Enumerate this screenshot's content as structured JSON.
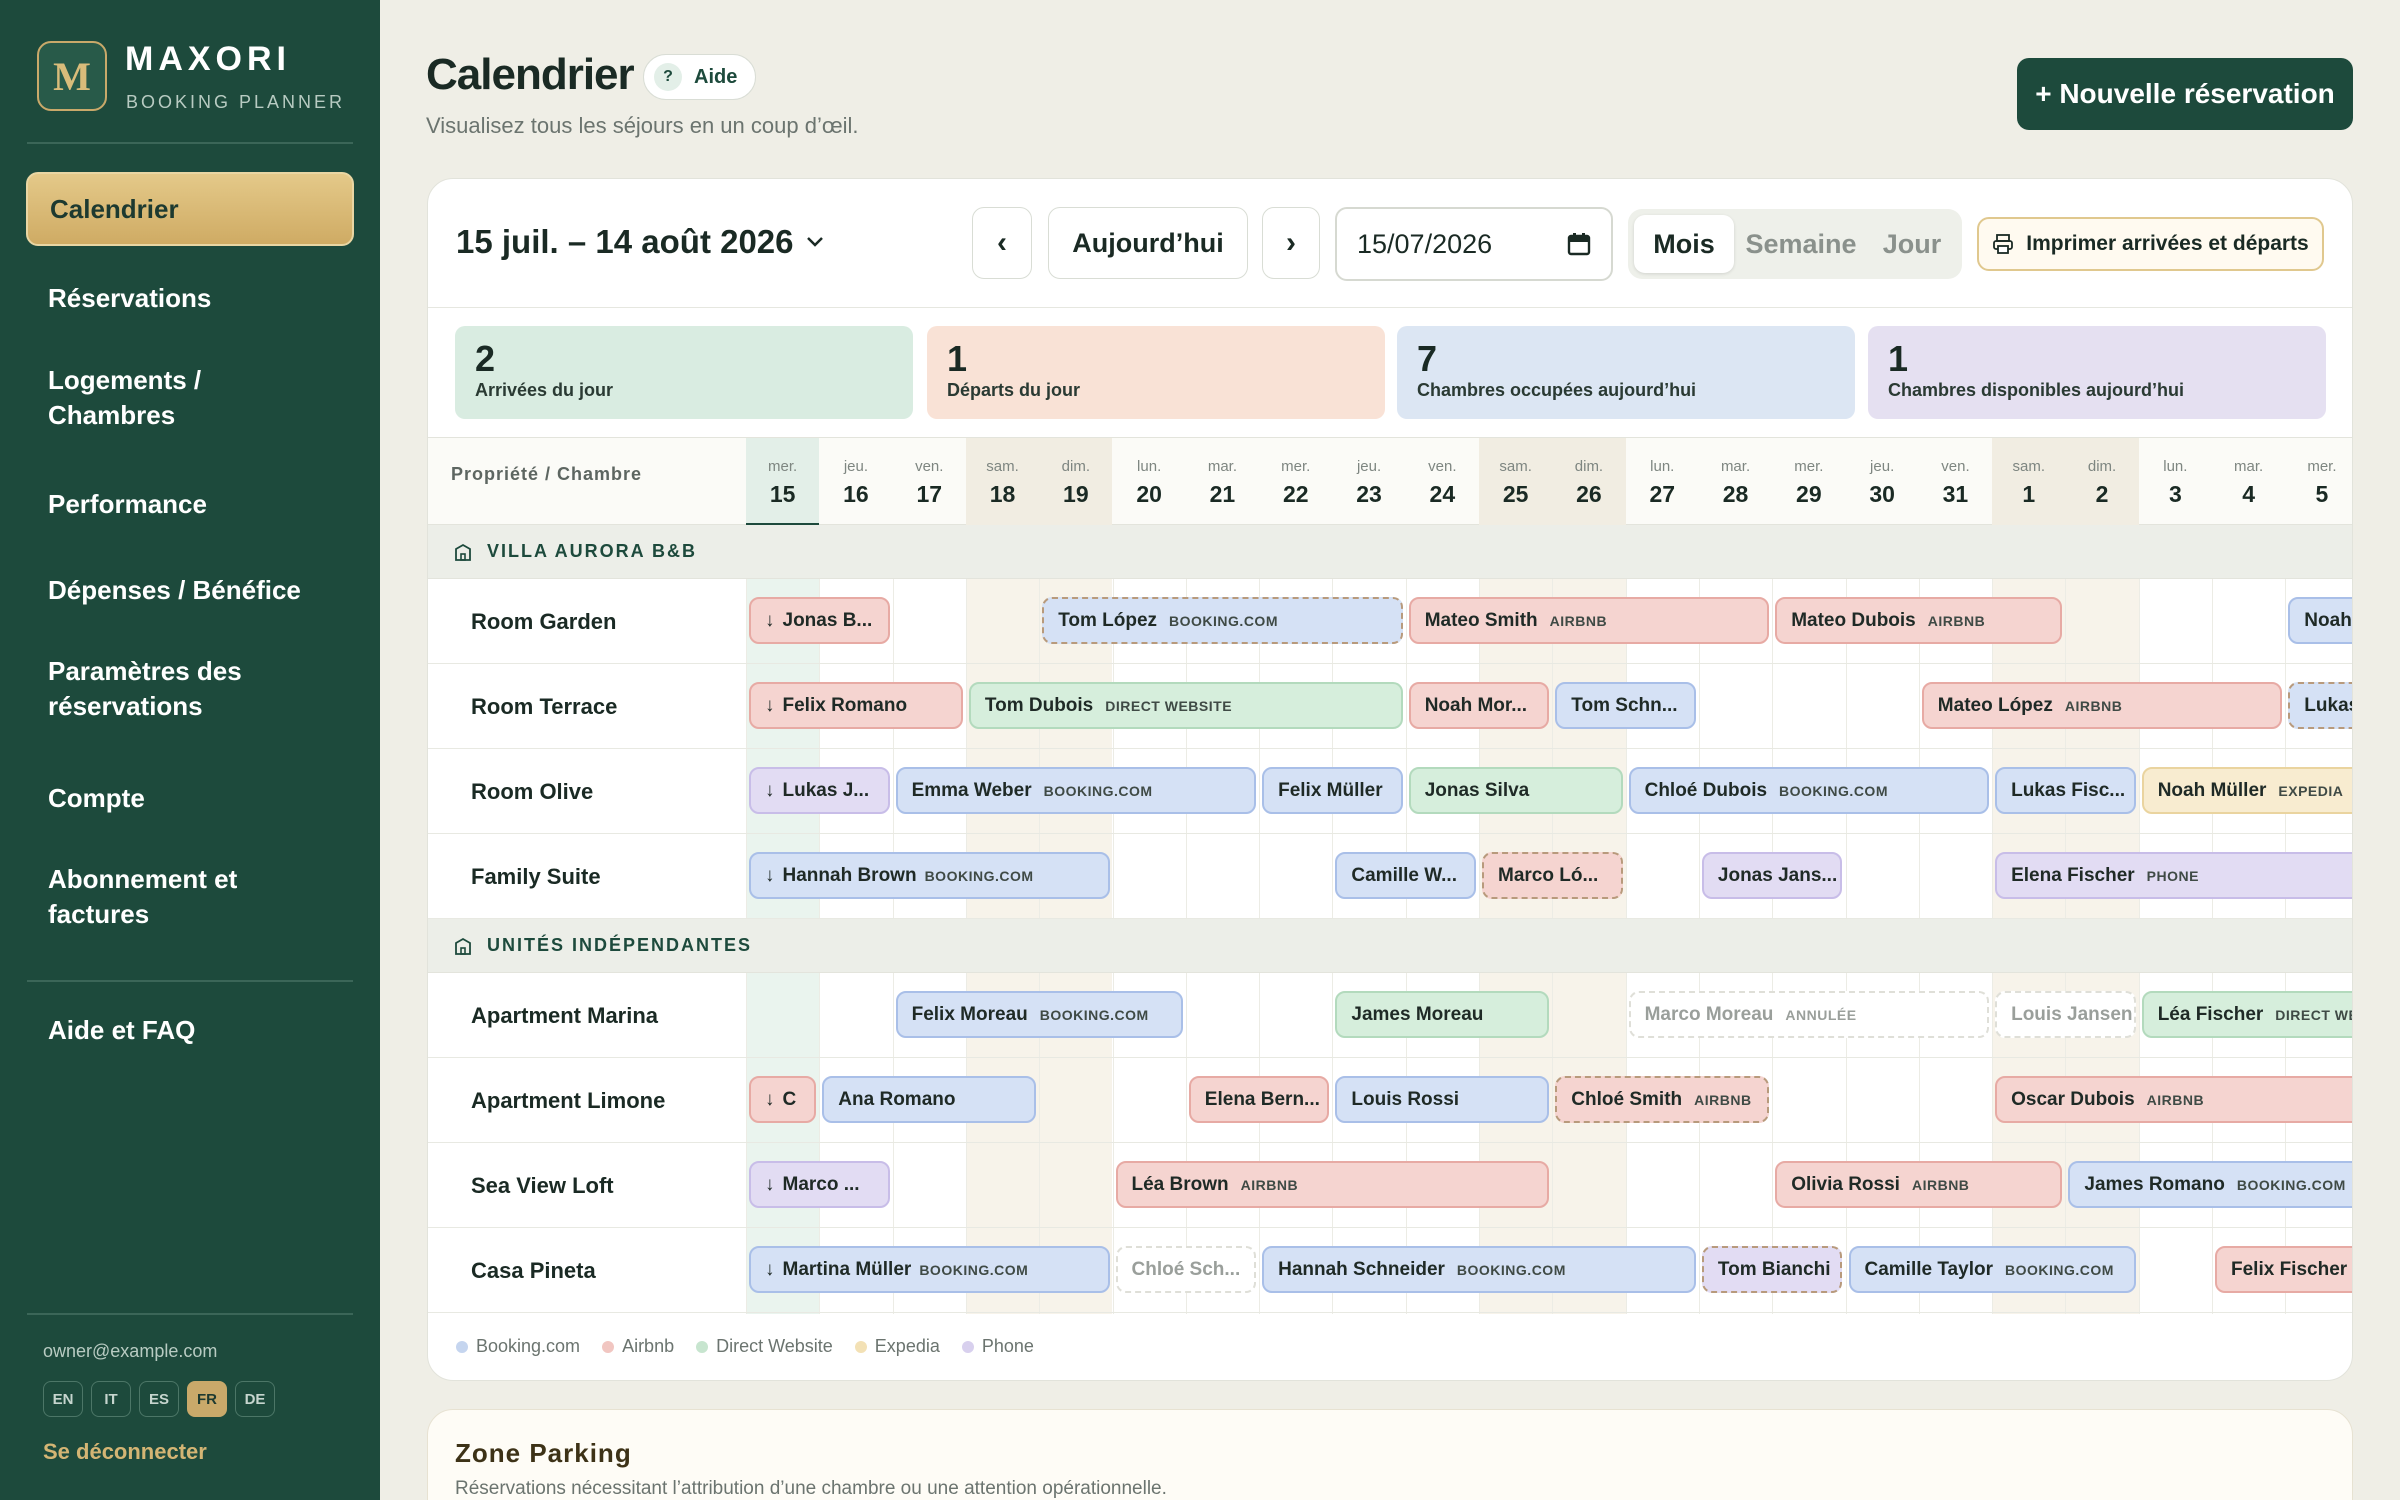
{
  "sidebar": {
    "logo_letter": "M",
    "brand": "MAXORI",
    "brand_sub": "BOOKING PLANNER",
    "nav": [
      "Calendrier",
      "Réservations",
      "Logements / Chambres",
      "Performance",
      "Dépenses / Bénéfice",
      "Paramètres des réservations",
      "Compte",
      "Abonnement et factures",
      "Aide et FAQ"
    ],
    "active_nav": "Calendrier",
    "email": "owner@example.com",
    "languages": [
      "EN",
      "IT",
      "ES",
      "FR",
      "DE"
    ],
    "active_language": "FR",
    "logout": "Se déconnecter"
  },
  "header": {
    "title": "Calendrier",
    "help": "Aide",
    "help_glyph": "?",
    "subtitle": "Visualisez tous les séjours en un coup d’œil.",
    "new_reservation": "+ Nouvelle réservation"
  },
  "toolbar": {
    "range": "15 juil. – 14 août 2026",
    "prev": "‹",
    "today": "Aujourd’hui",
    "next": "›",
    "date_value": "15/07/2026",
    "views": [
      "Mois",
      "Semaine",
      "Jour"
    ],
    "active_view": "Mois",
    "print": "Imprimer arrivées et départs"
  },
  "stats": [
    {
      "value": "2",
      "label": "Arrivées du jour",
      "color": "#d9ece1"
    },
    {
      "value": "1",
      "label": "Départs du jour",
      "color": "#f9e2d6"
    },
    {
      "value": "7",
      "label": "Chambres occupées aujourd’hui",
      "color": "#dce6f3"
    },
    {
      "value": "1",
      "label": "Chambres disponibles aujourd’hui",
      "color": "#e5e0f1"
    }
  ],
  "grid": {
    "column_label": "Propriété / Chambre",
    "days": [
      {
        "dn": "mer.",
        "dd": "15",
        "weekend": false,
        "today": true
      },
      {
        "dn": "jeu.",
        "dd": "16",
        "weekend": false
      },
      {
        "dn": "ven.",
        "dd": "17",
        "weekend": false
      },
      {
        "dn": "sam.",
        "dd": "18",
        "weekend": true
      },
      {
        "dn": "dim.",
        "dd": "19",
        "weekend": true
      },
      {
        "dn": "lun.",
        "dd": "20",
        "weekend": false
      },
      {
        "dn": "mar.",
        "dd": "21",
        "weekend": false
      },
      {
        "dn": "mer.",
        "dd": "22",
        "weekend": false
      },
      {
        "dn": "jeu.",
        "dd": "23",
        "weekend": false
      },
      {
        "dn": "ven.",
        "dd": "24",
        "weekend": false
      },
      {
        "dn": "sam.",
        "dd": "25",
        "weekend": true
      },
      {
        "dn": "dim.",
        "dd": "26",
        "weekend": true
      },
      {
        "dn": "lun.",
        "dd": "27",
        "weekend": false
      },
      {
        "dn": "mar.",
        "dd": "28",
        "weekend": false
      },
      {
        "dn": "mer.",
        "dd": "29",
        "weekend": false
      },
      {
        "dn": "jeu.",
        "dd": "30",
        "weekend": false
      },
      {
        "dn": "ven.",
        "dd": "31",
        "weekend": false
      },
      {
        "dn": "sam.",
        "dd": "1",
        "weekend": true
      },
      {
        "dn": "dim.",
        "dd": "2",
        "weekend": true
      },
      {
        "dn": "lun.",
        "dd": "3",
        "weekend": false
      },
      {
        "dn": "mar.",
        "dd": "4",
        "weekend": false
      },
      {
        "dn": "mer.",
        "dd": "5",
        "weekend": false
      }
    ],
    "groups": [
      {
        "name": "VILLA AURORA B&B",
        "rooms": [
          {
            "name": "Room Garden",
            "bookings": [
              {
                "start": 0,
                "span": 2,
                "guest": "Jonas B...",
                "source": "",
                "type": "airbnb",
                "arrival": true
              },
              {
                "start": 4,
                "span": 5,
                "guest": "Tom López",
                "source": "BOOKING.COM",
                "type": "booking",
                "dashed": true
              },
              {
                "start": 9,
                "span": 5,
                "guest": "Mateo Smith",
                "source": "AIRBNB",
                "type": "airbnb"
              },
              {
                "start": 14,
                "span": 4,
                "guest": "Mateo Dubois",
                "source": "AIRBNB",
                "type": "airbnb"
              },
              {
                "start": 21,
                "span": 1.6,
                "guest": "Noah",
                "source": "",
                "type": "booking"
              }
            ]
          },
          {
            "name": "Room Terrace",
            "bookings": [
              {
                "start": 0,
                "span": 3,
                "guest": "Felix Romano",
                "source": "",
                "type": "airbnb",
                "arrival": true
              },
              {
                "start": 3,
                "span": 6,
                "guest": "Tom Dubois",
                "source": "DIRECT WEBSITE",
                "type": "direct"
              },
              {
                "start": 9,
                "span": 2,
                "guest": "Noah Mor...",
                "source": "",
                "type": "airbnb"
              },
              {
                "start": 11,
                "span": 2,
                "guest": "Tom Schn...",
                "source": "",
                "type": "booking"
              },
              {
                "start": 16,
                "span": 5,
                "guest": "Mateo López",
                "source": "AIRBNB",
                "type": "airbnb"
              },
              {
                "start": 21,
                "span": 1.6,
                "guest": "Lukas",
                "source": "",
                "type": "booking",
                "dashed": true
              }
            ]
          },
          {
            "name": "Room Olive",
            "bookings": [
              {
                "start": 0,
                "span": 2,
                "guest": "Lukas J...",
                "source": "",
                "type": "phone",
                "arrival": true
              },
              {
                "start": 2,
                "span": 5,
                "guest": "Emma Weber",
                "source": "BOOKING.COM",
                "type": "booking"
              },
              {
                "start": 7,
                "span": 2,
                "guest": "Felix Müller",
                "source": "",
                "type": "booking"
              },
              {
                "start": 9,
                "span": 3,
                "guest": "Jonas Silva",
                "source": "",
                "type": "direct"
              },
              {
                "start": 12,
                "span": 5,
                "guest": "Chloé Dubois",
                "source": "BOOKING.COM",
                "type": "booking"
              },
              {
                "start": 17,
                "span": 2,
                "guest": "Lukas Fisc...",
                "source": "",
                "type": "booking"
              },
              {
                "start": 19,
                "span": 3.6,
                "guest": "Noah Müller",
                "source": "EXPEDIA",
                "type": "expedia"
              }
            ]
          },
          {
            "name": "Family Suite",
            "bookings": [
              {
                "start": 0,
                "span": 5,
                "guest": "Hannah Brown",
                "source": "BOOKING.COM",
                "type": "booking",
                "arrival": true
              },
              {
                "start": 8,
                "span": 2,
                "guest": "Camille W...",
                "source": "",
                "type": "booking"
              },
              {
                "start": 10,
                "span": 2,
                "guest": "Marco Ló...",
                "source": "",
                "type": "airbnb",
                "dashed": true
              },
              {
                "start": 13,
                "span": 2,
                "guest": "Jonas Jans...",
                "source": "",
                "type": "phone"
              },
              {
                "start": 17,
                "span": 5.6,
                "guest": "Elena Fischer",
                "source": "PHONE",
                "type": "phone"
              }
            ]
          }
        ]
      },
      {
        "name": "UNITÉS INDÉPENDANTES",
        "rooms": [
          {
            "name": "Apartment Marina",
            "bookings": [
              {
                "start": 2,
                "span": 4,
                "guest": "Felix Moreau",
                "source": "BOOKING.COM",
                "type": "booking"
              },
              {
                "start": 8,
                "span": 3,
                "guest": "James Moreau",
                "source": "",
                "type": "direct"
              },
              {
                "start": 12,
                "span": 5,
                "guest": "Marco Moreau",
                "source": "ANNULÉE",
                "type": "cancelled"
              },
              {
                "start": 17,
                "span": 2,
                "guest": "Louis Jansen",
                "source": "",
                "type": "cancelled"
              },
              {
                "start": 19,
                "span": 3.6,
                "guest": "Léa Fischer",
                "source": "DIRECT WEBSITE",
                "type": "direct"
              }
            ]
          },
          {
            "name": "Apartment Limone",
            "bookings": [
              {
                "start": 0,
                "span": 1,
                "guest": "C",
                "source": "",
                "type": "airbnb",
                "arrival": true
              },
              {
                "start": 1,
                "span": 3,
                "guest": "Ana Romano",
                "source": "",
                "type": "booking"
              },
              {
                "start": 6,
                "span": 2,
                "guest": "Elena Bern...",
                "source": "",
                "type": "airbnb"
              },
              {
                "start": 8,
                "span": 3,
                "guest": "Louis Rossi",
                "source": "",
                "type": "booking"
              },
              {
                "start": 11,
                "span": 3,
                "guest": "Chloé Smith",
                "source": "AIRBNB",
                "type": "airbnb",
                "dashed": true
              },
              {
                "start": 17,
                "span": 5.6,
                "guest": "Oscar Dubois",
                "source": "AIRBNB",
                "type": "airbnb"
              }
            ]
          },
          {
            "name": "Sea View Loft",
            "bookings": [
              {
                "start": 0,
                "span": 2,
                "guest": "Marco ...",
                "source": "",
                "type": "phone",
                "arrival": true
              },
              {
                "start": 5,
                "span": 6,
                "guest": "Léa Brown",
                "source": "AIRBNB",
                "type": "airbnb"
              },
              {
                "start": 14,
                "span": 4,
                "guest": "Olivia Rossi",
                "source": "AIRBNB",
                "type": "airbnb"
              },
              {
                "start": 18,
                "span": 4.6,
                "guest": "James Romano",
                "source": "BOOKING.COM",
                "type": "booking"
              }
            ]
          },
          {
            "name": "Casa Pineta",
            "bookings": [
              {
                "start": 0,
                "span": 5,
                "guest": "Martina Müller",
                "source": "BOOKING.COM",
                "type": "booking",
                "arrival": true
              },
              {
                "start": 5,
                "span": 2,
                "guest": "Chloé Sch...",
                "source": "",
                "type": "cancelled"
              },
              {
                "start": 7,
                "span": 6,
                "guest": "Hannah Schneider",
                "source": "BOOKING.COM",
                "type": "booking"
              },
              {
                "start": 13,
                "span": 2,
                "guest": "Tom Bianchi",
                "source": "",
                "type": "phone",
                "dashed": true
              },
              {
                "start": 15,
                "span": 4,
                "guest": "Camille Taylor",
                "source": "BOOKING.COM",
                "type": "booking"
              },
              {
                "start": 20,
                "span": 2.6,
                "guest": "Felix Fischer",
                "source": "",
                "type": "airbnb"
              }
            ]
          }
        ]
      }
    ],
    "arrival_glyph": "↓"
  },
  "legend": [
    {
      "label": "Booking.com",
      "color": "#c5d5ef"
    },
    {
      "label": "Airbnb",
      "color": "#f1c6c1"
    },
    {
      "label": "Direct Website",
      "color": "#c7e5cf"
    },
    {
      "label": "Expedia",
      "color": "#f3e1b5"
    },
    {
      "label": "Phone",
      "color": "#d8d0ee"
    }
  ],
  "parking": {
    "title": "Zone Parking",
    "subtitle": "Réservations nécessitant l’attribution d’une chambre ou une attention opérationnelle."
  }
}
